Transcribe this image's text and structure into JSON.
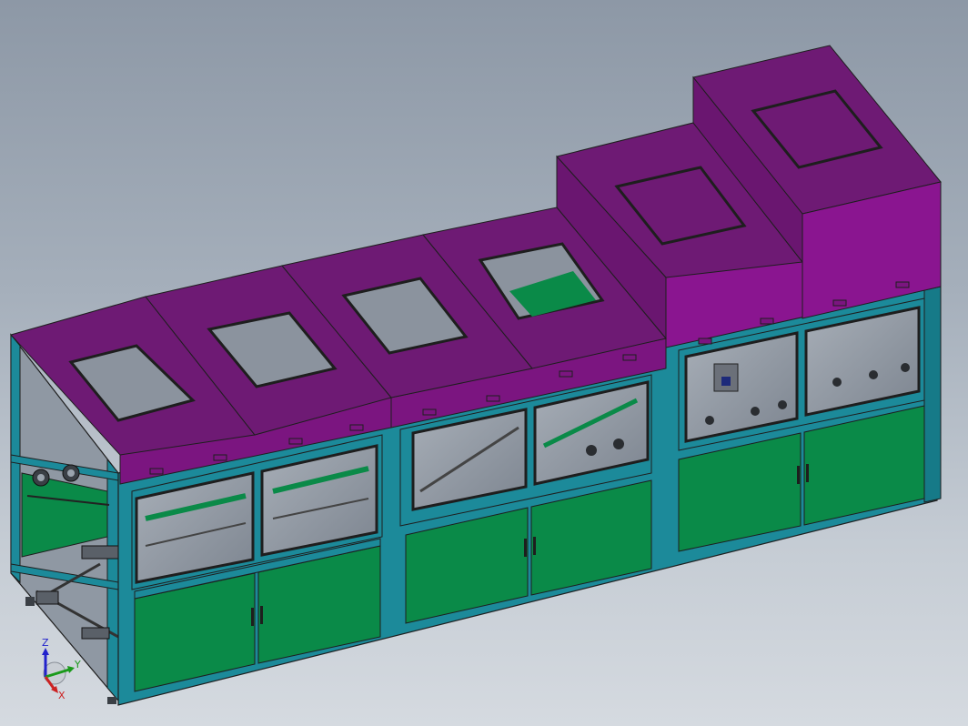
{
  "viewport": {
    "background_top": "#8d98a6",
    "background_bottom": "#d5dae0"
  },
  "model": {
    "description_kind": "3D CAD assembly render (shaded with edges)",
    "colors": {
      "lid_top": "#6e1a74",
      "lid_front": "#7b1580",
      "lid_side": "#8a1590",
      "frame": "#1c8a9a",
      "panel": "#0a8a48",
      "panel_light": "#139a55",
      "window_glass": "#8d95a0",
      "edge": "#1e1e1e"
    }
  },
  "triad": {
    "z_label": "Z",
    "y_label": "Y",
    "x_label": "X",
    "z_color": "#2222cc",
    "y_color": "#1a9a1a",
    "x_color": "#cc2222"
  }
}
